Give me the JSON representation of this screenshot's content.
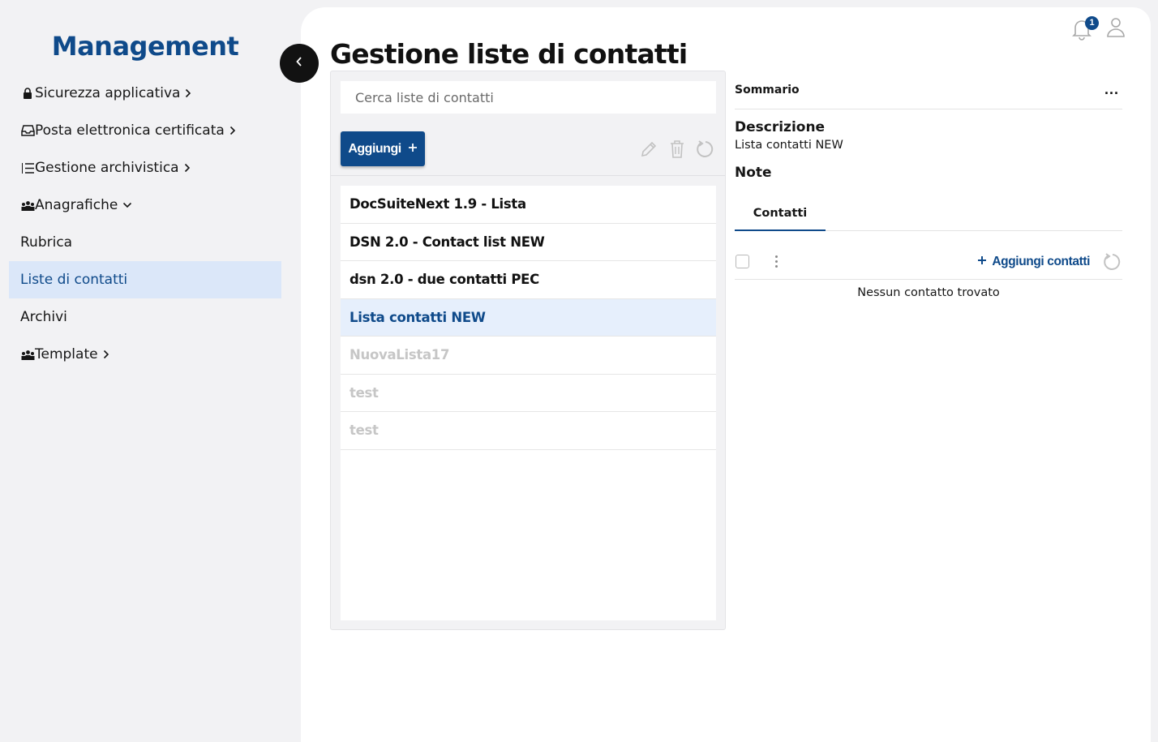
{
  "sidebar": {
    "brand": "Management",
    "items": [
      {
        "label": "Sicurezza applicativa",
        "icon": "lock-icon"
      },
      {
        "label": "Posta elettronica certificata",
        "icon": "inbox-icon"
      },
      {
        "label": "Gestione archivistica",
        "icon": "list-icon"
      },
      {
        "label": "Anagrafiche",
        "icon": "people-icon"
      },
      {
        "label": "Rubrica"
      },
      {
        "label": "Liste di contatti"
      },
      {
        "label": "Archivi"
      },
      {
        "label": "Template",
        "icon": "people-icon"
      }
    ]
  },
  "header": {
    "title": "Gestione liste di contatti",
    "notification_count": "1"
  },
  "list_panel": {
    "search_placeholder": "Cerca liste di contatti",
    "add_label": "Aggiungi",
    "items": [
      {
        "label": "DocSuiteNext 1.9 - Lista",
        "state": "normal"
      },
      {
        "label": "DSN 2.0 - Contact list NEW",
        "state": "normal"
      },
      {
        "label": "dsn 2.0 - due contatti PEC",
        "state": "normal"
      },
      {
        "label": "Lista contatti NEW",
        "state": "selected"
      },
      {
        "label": "NuovaLista17",
        "state": "disabled"
      },
      {
        "label": "test",
        "state": "disabled"
      },
      {
        "label": "test",
        "state": "disabled"
      }
    ]
  },
  "detail": {
    "summary_title": "Sommario",
    "more_label": "...",
    "description_label": "Descrizione",
    "description_value": "Lista contatti NEW",
    "note_label": "Note",
    "tab_label": "Contatti",
    "add_contacts_label": "Aggiungi contatti",
    "empty_message": "Nessun contatto trovato"
  },
  "colors": {
    "accent": "#0f4a8a",
    "selected_bg": "#dbe7f9"
  }
}
